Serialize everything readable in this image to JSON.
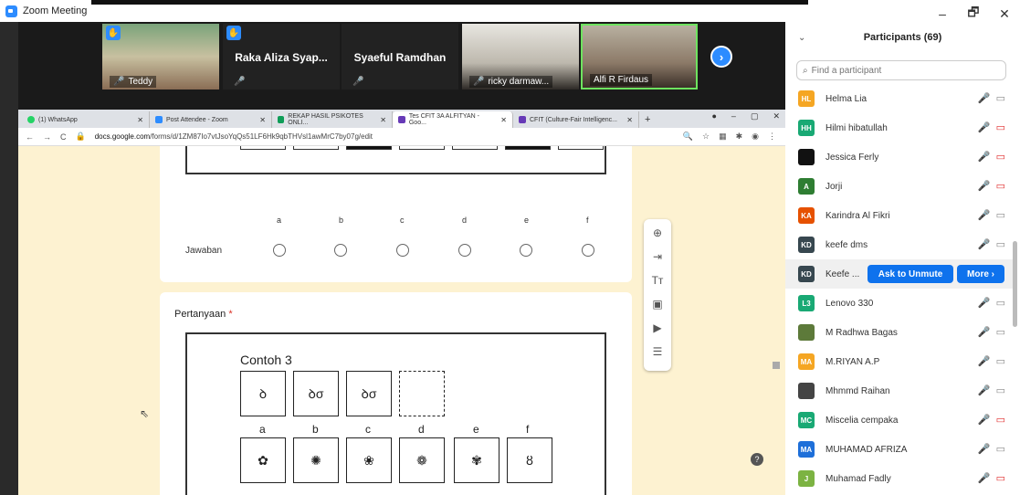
{
  "zoom": {
    "window_title": "Zoom Meeting",
    "win_min": "–",
    "win_max": "🗗",
    "win_close": "✕"
  },
  "video_strip": {
    "tiles": [
      {
        "name": "Teddy"
      },
      {
        "name": "Raka Aliza Syap..."
      },
      {
        "name": "Syaeful Ramdhan"
      },
      {
        "name": "ricky darmaw..."
      },
      {
        "name": "Alfi R Firdaus"
      }
    ],
    "next_arrow": "›"
  },
  "browser": {
    "tabs": [
      {
        "label": "(1) WhatsApp",
        "color": "#25d366"
      },
      {
        "label": "Post Attendee - Zoom",
        "color": "#2d8cff"
      },
      {
        "label": "REKAP HASIL PSIKOTES ONLI...",
        "color": "#0f9d58"
      },
      {
        "label": "Tes CFIT 3A ALFITYAN - Goo...",
        "color": "#673ab7"
      },
      {
        "label": "CFIT (Culture-Fair Intelligenc...",
        "color": "#673ab7"
      }
    ],
    "new_tab": "+",
    "url_host": "docs.google.com",
    "url_path": "/forms/d/1ZM87Io7vtJsoYqQs51LF6Hk9qbTHVsl1awMrC7by07g/edit",
    "nav_back": "←",
    "nav_forward": "→",
    "nav_reload": "C"
  },
  "form": {
    "choices": [
      "a",
      "b",
      "c",
      "d",
      "e",
      "f"
    ],
    "answer_label": "Jawaban",
    "question_label": "Pertanyaan",
    "required_mark": "*",
    "contoh_title": "Contoh 3",
    "answer_letters": [
      "a",
      "b",
      "c",
      "d",
      "e",
      "f"
    ]
  },
  "participants": {
    "title": "Participants (69)",
    "search_placeholder": "Find a participant",
    "list": [
      {
        "initials": "HL",
        "name": "Helma Lia",
        "color": "#f5a623"
      },
      {
        "initials": "HH",
        "name": "Hilmi hibatullah",
        "color": "#19a974"
      },
      {
        "initials": "",
        "name": "Jessica Ferly",
        "color": "#111111"
      },
      {
        "initials": "A",
        "name": "Jorji",
        "color": "#2e7d32"
      },
      {
        "initials": "KA",
        "name": "Karindra Al Fikri",
        "color": "#e65100"
      },
      {
        "initials": "KD",
        "name": "keefe dms",
        "color": "#37474f"
      },
      {
        "initials": "KD",
        "name": "Keefe ...",
        "color": "#37474f"
      },
      {
        "initials": "L3",
        "name": "Lenovo 330",
        "color": "#19a974"
      },
      {
        "initials": "",
        "name": "M Radhwa Bagas",
        "color": "#5d7a3a"
      },
      {
        "initials": "MA",
        "name": "M.RIYAN A.P",
        "color": "#f5a623"
      },
      {
        "initials": "",
        "name": "Mhmmd Raihan",
        "color": "#444444"
      },
      {
        "initials": "MC",
        "name": "Miscelia cempaka",
        "color": "#19a974"
      },
      {
        "initials": "MA",
        "name": "MUHAMAD AFRIZA",
        "color": "#1e6fd9"
      },
      {
        "initials": "J",
        "name": "Muhamad Fadly",
        "color": "#7cb342"
      }
    ],
    "ask_to_unmute": "Ask to Unmute",
    "more": "More ›"
  }
}
